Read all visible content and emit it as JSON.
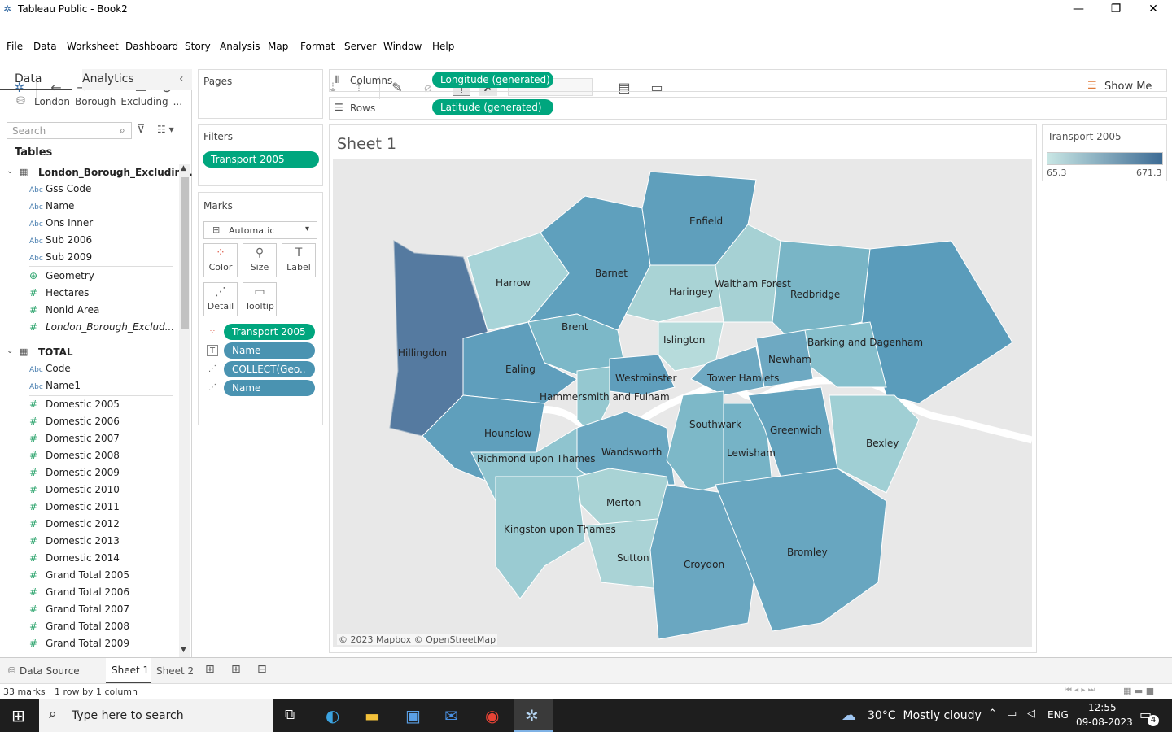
{
  "window": {
    "title": "Tableau Public - Book2",
    "minimize": "—",
    "restore": "❐",
    "close": "✕"
  },
  "menu": [
    "File",
    "Data",
    "Worksheet",
    "Dashboard",
    "Story",
    "Analysis",
    "Map",
    "Format",
    "Server",
    "Window",
    "Help"
  ],
  "toolbar": {
    "show_me": "Show Me"
  },
  "left": {
    "tab_data": "Data",
    "tab_analytics": "Analytics",
    "datasource": "London_Borough_Excluding_...",
    "search_placeholder": "Search",
    "tables_heading": "Tables",
    "table1": "London_Borough_Excludin...",
    "table1_fields": [
      {
        "icon": "Abc",
        "name": "Gss Code"
      },
      {
        "icon": "Abc",
        "name": "Name"
      },
      {
        "icon": "Abc",
        "name": "Ons Inner"
      },
      {
        "icon": "Abc",
        "name": "Sub 2006"
      },
      {
        "icon": "Abc",
        "name": "Sub 2009"
      },
      {
        "icon": "⊕",
        "name": "Geometry"
      },
      {
        "icon": "#",
        "name": "Hectares"
      },
      {
        "icon": "#",
        "name": "Nonld Area"
      },
      {
        "icon": "#",
        "name": "London_Borough_Exclud..."
      }
    ],
    "table2": "TOTAL",
    "table2_fields": [
      {
        "icon": "Abc",
        "name": "Code"
      },
      {
        "icon": "Abc",
        "name": "Name1"
      },
      {
        "icon": "#",
        "name": "Domestic 2005"
      },
      {
        "icon": "#",
        "name": "Domestic 2006"
      },
      {
        "icon": "#",
        "name": "Domestic 2007"
      },
      {
        "icon": "#",
        "name": "Domestic 2008"
      },
      {
        "icon": "#",
        "name": "Domestic 2009"
      },
      {
        "icon": "#",
        "name": "Domestic 2010"
      },
      {
        "icon": "#",
        "name": "Domestic 2011"
      },
      {
        "icon": "#",
        "name": "Domestic 2012"
      },
      {
        "icon": "#",
        "name": "Domestic 2013"
      },
      {
        "icon": "#",
        "name": "Domestic 2014"
      },
      {
        "icon": "#",
        "name": "Grand Total 2005"
      },
      {
        "icon": "#",
        "name": "Grand Total 2006"
      },
      {
        "icon": "#",
        "name": "Grand Total 2007"
      },
      {
        "icon": "#",
        "name": "Grand Total 2008"
      },
      {
        "icon": "#",
        "name": "Grand Total 2009"
      }
    ]
  },
  "shelves": {
    "pages": "Pages",
    "filters": "Filters",
    "filter_pill": "Transport 2005",
    "marks": "Marks",
    "mark_type": "Automatic",
    "buttons": [
      "Color",
      "Size",
      "Label",
      "Detail",
      "Tooltip"
    ],
    "mark_pills": [
      "Transport 2005",
      "Name",
      "COLLECT(Geo..",
      "Name"
    ],
    "columns_label": "Columns",
    "columns_pill": "Longitude (generated)",
    "rows_label": "Rows",
    "rows_pill": "Latitude (generated)"
  },
  "sheet": {
    "title": "Sheet 1",
    "attribution": "© 2023 Mapbox © OpenStreetMap"
  },
  "boroughs": [
    "Enfield",
    "Barnet",
    "Harrow",
    "Haringey",
    "Waltham Forest",
    "Redbridge",
    "Brent",
    "Islington",
    "Barking and Dagenham",
    "Hillingdon",
    "Newham",
    "Ealing",
    "Westminster",
    "Tower Hamlets",
    "Hammersmith and Fulham",
    "Southwark",
    "Greenwich",
    "Hounslow",
    "Bexley",
    "Wandsworth",
    "Lewisham",
    "Richmond upon Thames",
    "Merton",
    "Kingston upon Thames",
    "Sutton",
    "Croydon",
    "Bromley"
  ],
  "legend": {
    "title": "Transport 2005",
    "min": "65.3",
    "max": "671.3",
    "color_low": "#c8e6e4",
    "color_high": "#3d6b94"
  },
  "bottom": {
    "data_source": "Data Source",
    "sheet1": "Sheet 1",
    "sheet2": "Sheet 2"
  },
  "status": {
    "marks": "33 marks",
    "dims": "1 row by 1 column"
  },
  "taskbar": {
    "search": "Type here to search",
    "weather": "30°C  Mostly cloudy",
    "lang": "ENG",
    "time": "12:55",
    "date": "09-08-2023",
    "notif": "4"
  }
}
